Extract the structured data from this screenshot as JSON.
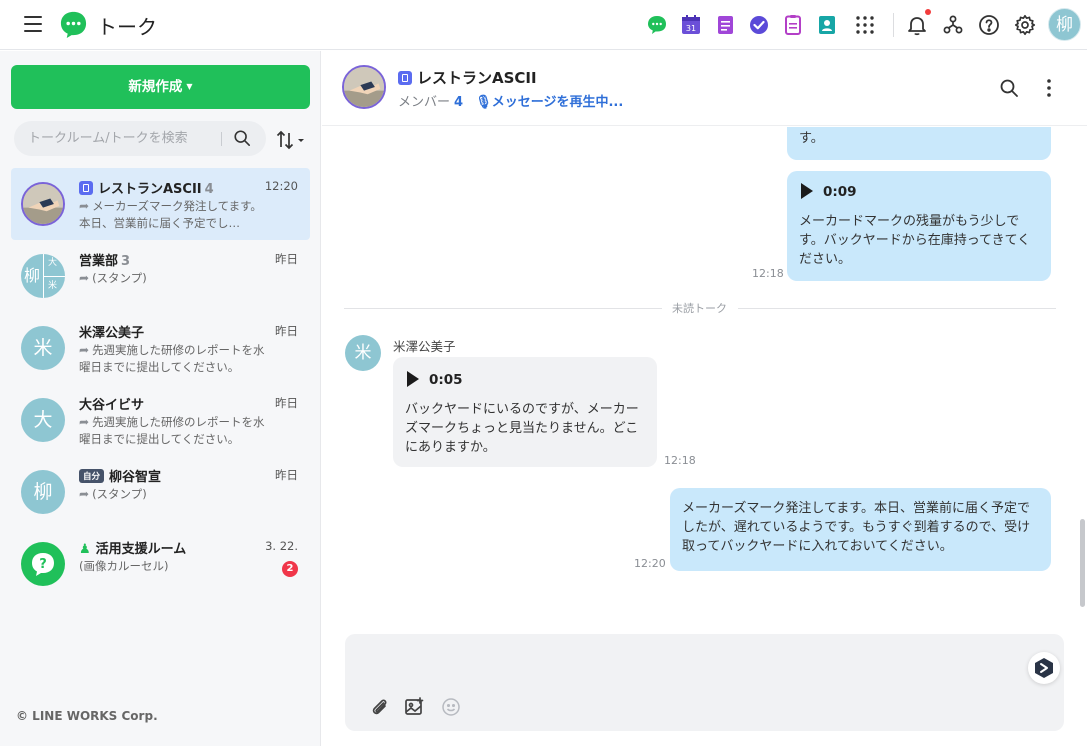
{
  "app": {
    "title": "トーク"
  },
  "user": {
    "avatar_initial": "柳"
  },
  "header_icons": [
    "talk-service-icon",
    "calendar-icon",
    "note-icon",
    "task-check-icon",
    "form-icon",
    "contacts-icon",
    "apps-grid-icon",
    "notification-bell-icon",
    "org-chart-icon",
    "help-icon",
    "settings-icon"
  ],
  "calendar_day": "31",
  "sidebar": {
    "new_button": "新規作成",
    "search_placeholder": "トークルーム/トークを検索",
    "rooms": [
      {
        "name": "レストランASCII",
        "count": "4",
        "time": "12:20",
        "preview": "メーカーズマーク発注してます。本日、営業前に届く予定でし…",
        "active": true
      },
      {
        "name": "営業部",
        "count": "3",
        "time": "昨日",
        "preview": "(スタンプ)",
        "avatar_chars": [
          "柳",
          "大",
          "米"
        ]
      },
      {
        "name": "米澤公美子",
        "time": "昨日",
        "preview": "先週実施した研修のレポートを水曜日までに提出してください。",
        "avatar_initial": "米"
      },
      {
        "name": "大谷イビサ",
        "time": "昨日",
        "preview": "先週実施した研修のレポートを水曜日までに提出してください。",
        "avatar_initial": "大"
      },
      {
        "name": "柳谷智宣",
        "badge": "自分",
        "time": "昨日",
        "preview": "(スタンプ)",
        "avatar_initial": "柳"
      },
      {
        "name": "活用支援ルーム",
        "time": "3. 22.",
        "preview": "(画像カルーセル)",
        "unread": "2"
      }
    ],
    "copyright": "© LINE WORKS Corp."
  },
  "chat": {
    "title": "レストランASCII",
    "members_label": "メンバー",
    "members_count": "4",
    "playing_label": "メッセージを再生中...",
    "messages": [
      {
        "direction": "out",
        "text": "す。"
      },
      {
        "direction": "out",
        "duration": "0:09",
        "text": "メーカードマークの残量がもう少しです。バックヤードから在庫持ってきてください。",
        "time": "12:18"
      },
      {
        "divider": "未読トーク"
      },
      {
        "direction": "in",
        "sender": "米澤公美子",
        "sender_initial": "米",
        "duration": "0:05",
        "text": "バックヤードにいるのですが、メーカーズマークちょっと見当たりません。どこにありますか。",
        "time": "12:18"
      },
      {
        "direction": "out",
        "text": "メーカーズマーク発注してます。本日、営業前に届く予定でしたが、遅れているようです。もうすぐ到着するので、受け取ってバックヤードに入れておいてください。",
        "time": "12:20"
      }
    ],
    "typing": "..."
  },
  "colors": {
    "brand_green": "#20c05a",
    "active_row": "#dcebfa",
    "outgoing_bubble": "#c9e8fb",
    "incoming_bubble": "#f1f2f4",
    "link_blue": "#2f6fd8",
    "badge_red": "#f0364a"
  }
}
